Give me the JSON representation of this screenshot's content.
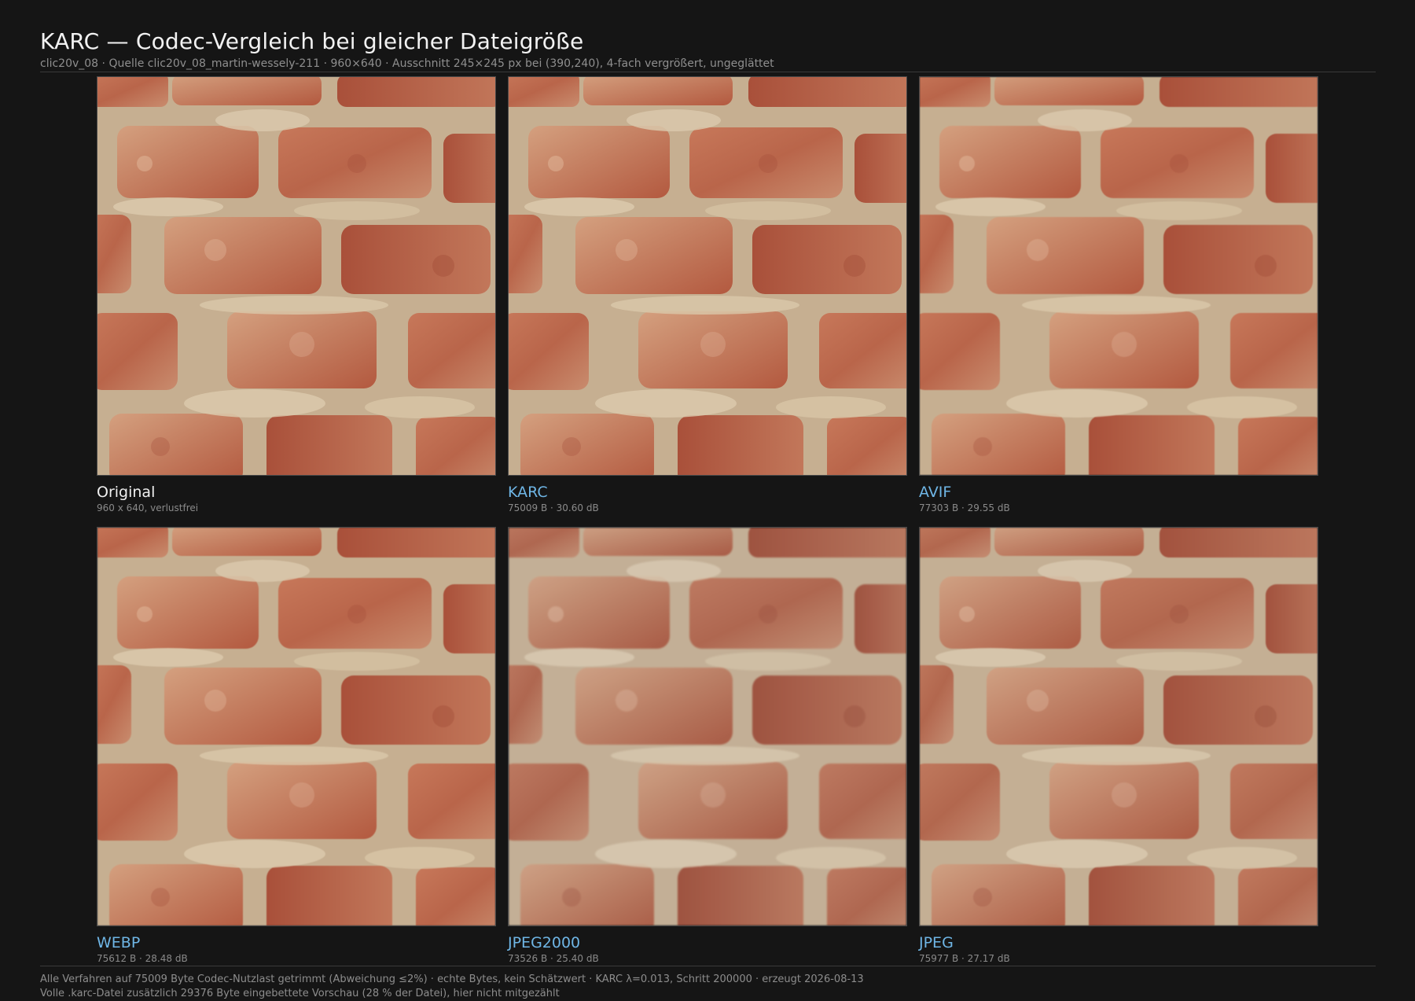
{
  "header": {
    "title": "KARC — Codec-Vergleich bei gleicher Dateigröße",
    "subtitle": "clic20v_08 · Quelle clic20v_08_martin-wessely-211 · 960×640 · Ausschnitt 245×245 px bei (390,240), 4-fach vergrößert, ungeglättet"
  },
  "tiles": [
    {
      "label": "Original",
      "meta": "960 x 640, verlustfrei",
      "accent": false
    },
    {
      "label": "KARC",
      "meta": "75009 B · 30.60 dB",
      "accent": true
    },
    {
      "label": "AVIF",
      "meta": "77303 B · 29.55 dB",
      "accent": true
    },
    {
      "label": "WEBP",
      "meta": "75612 B · 28.48 dB",
      "accent": true
    },
    {
      "label": "JPEG2000",
      "meta": "73526 B · 25.40 dB",
      "accent": true
    },
    {
      "label": "JPEG",
      "meta": "75977 B · 27.17 dB",
      "accent": true
    }
  ],
  "footer": {
    "line1": "Alle Verfahren auf 75009 Byte Codec-Nutzlast getrimmt (Abweichung ≤2%)  ·  echte Bytes, kein Schätzwert  ·  KARC λ=0.013, Schritt 200000  ·  erzeugt 2026-08-13",
    "line2": "Volle .karc-Datei zusätzlich 29376 Byte eingebettete Vorschau (28 % der Datei), hier nicht mitgezählt"
  },
  "colors": {
    "background": "#151515",
    "codec_label": "#6fb6e6",
    "brick": "#b8664a",
    "mortar": "#d6c4a6"
  },
  "image_content": "brick-wall-crop"
}
